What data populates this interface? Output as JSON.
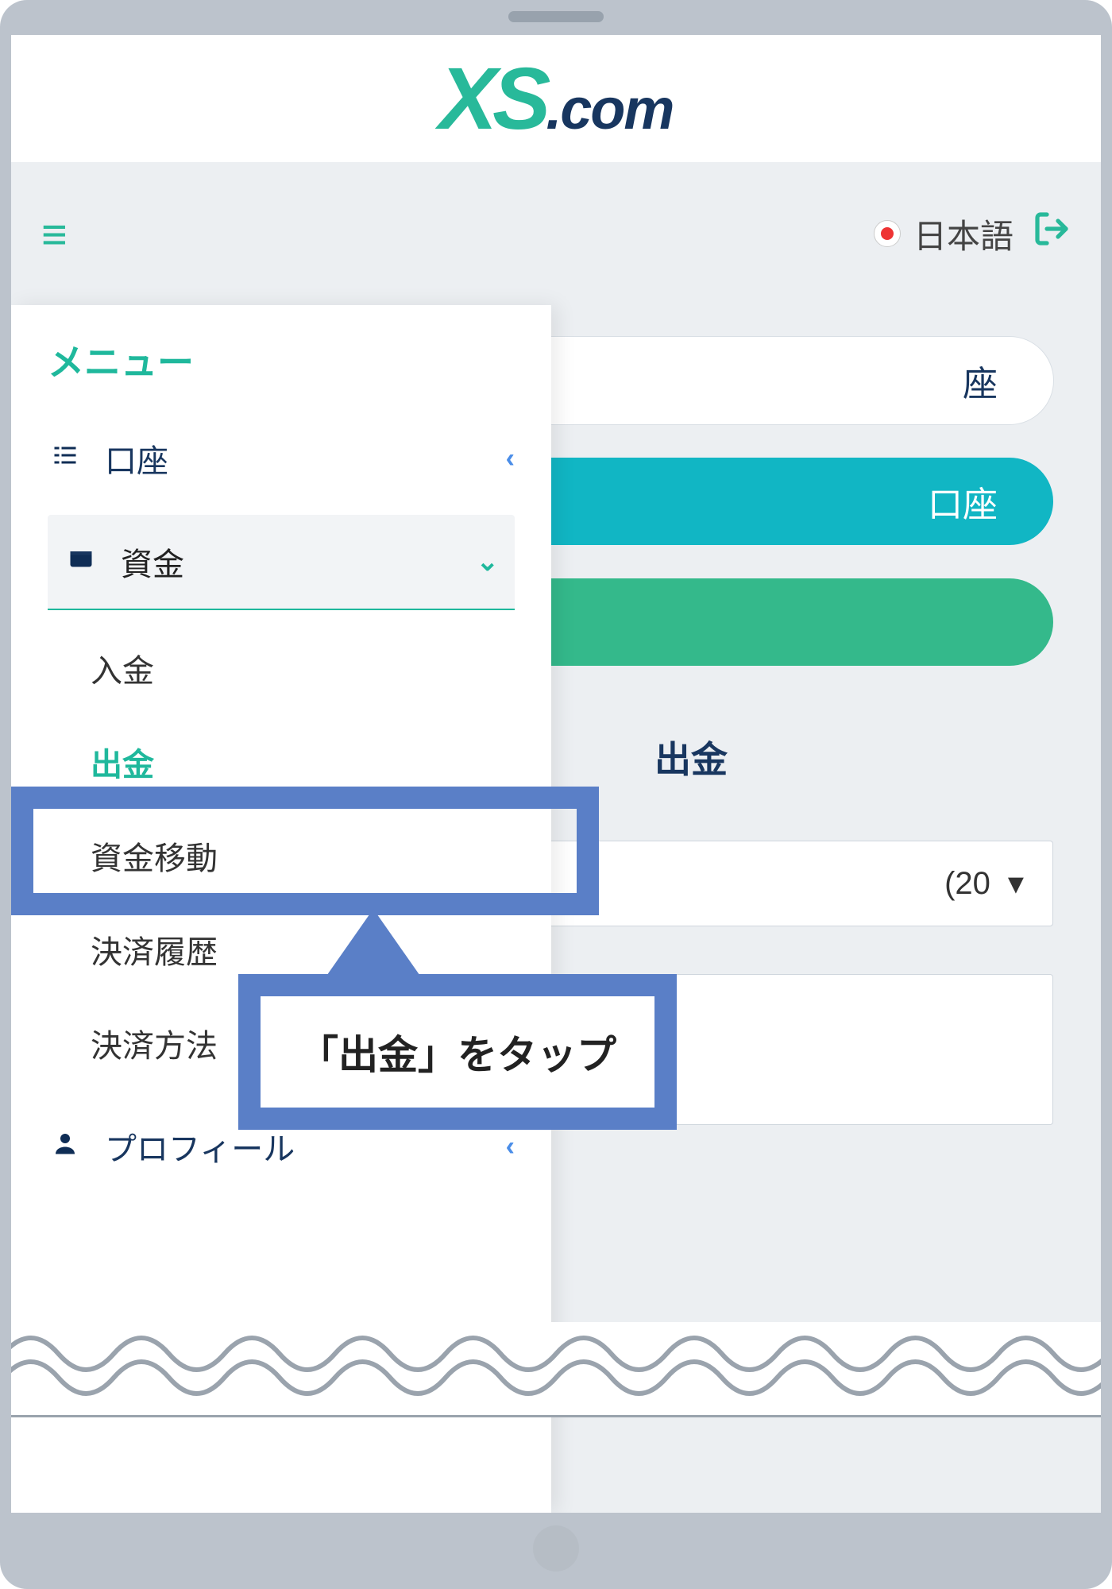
{
  "logo": {
    "xs": "XS",
    "dotcom": ".com"
  },
  "header": {
    "hamburger_aria": "menu",
    "language_label": "日本語",
    "logout_aria": "logout"
  },
  "page": {
    "pill_white_suffix": "座",
    "pill_teal_suffix": "口座",
    "pill_green_suffix": "",
    "section_title": "出金",
    "select_value": "(20",
    "select_caret": "▾"
  },
  "menu": {
    "title": "メニュー",
    "items": {
      "accounts": {
        "label": "口座",
        "icon": "list-icon"
      },
      "funds": {
        "label": "資金",
        "icon": "wallet-icon"
      },
      "profile": {
        "label": "プロフィール",
        "icon": "user-icon"
      }
    },
    "funds_sub": {
      "deposit": "入金",
      "withdraw": "出金",
      "transfer": "資金移動",
      "history": "決済履歴",
      "methods": "決済方法"
    }
  },
  "callout": {
    "text": "「出金」をタップ"
  }
}
